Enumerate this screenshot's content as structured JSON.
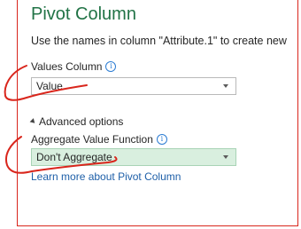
{
  "dialog": {
    "title": "Pivot Column",
    "instructions": "Use the names in column \"Attribute.1\" to create new"
  },
  "values_column": {
    "label": "Values Column",
    "value": "Value",
    "info_icon": "info-icon"
  },
  "advanced": {
    "toggle_label": "Advanced options",
    "aggregate_label": "Aggregate Value Function",
    "aggregate_value": "Don't Aggregate",
    "info_icon": "info-icon"
  },
  "link": {
    "learn_more": "Learn more about Pivot Column"
  },
  "colors": {
    "title": "#217346",
    "annotation": "#d9261c",
    "selected_bg": "#d9efdf",
    "link": "#1e5fa8"
  }
}
